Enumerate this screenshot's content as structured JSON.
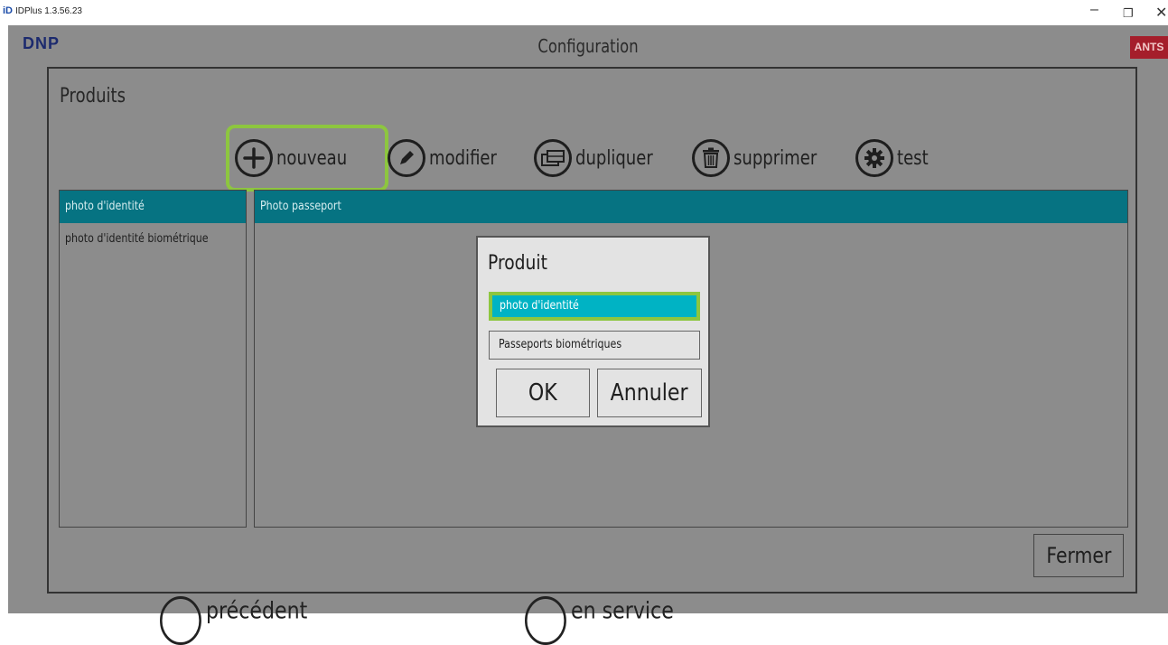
{
  "window": {
    "title": "IDPlus 1.3.56.23",
    "app_icon_text": "iD",
    "buttons": [
      "minimize",
      "restore",
      "close"
    ]
  },
  "app": {
    "brand": "DNP",
    "title": "Configuration",
    "badge": "ANTS",
    "bottom_nav": {
      "previous": "précédent",
      "in_service": "en service"
    }
  },
  "panel": {
    "title": "Produits",
    "toolbar": [
      {
        "label": "nouveau",
        "icon": "plus-icon"
      },
      {
        "label": "modifier",
        "icon": "pencil-icon"
      },
      {
        "label": "dupliquer",
        "icon": "duplicate-icon"
      },
      {
        "label": "supprimer",
        "icon": "trash-icon"
      },
      {
        "label": "test",
        "icon": "gear-icon"
      }
    ],
    "left_list": [
      "photo d'identité",
      "photo d'identité biométrique"
    ],
    "right_list": [
      "Photo passeport"
    ],
    "close_label": "Fermer"
  },
  "dialog": {
    "title": "Produit",
    "options": [
      "photo d'identité",
      "Passeports biométriques"
    ],
    "ok_label": "OK",
    "cancel_label": "Annuler"
  },
  "colors": {
    "background": "#8c8c8c",
    "selection": "#067382",
    "dialog_selection": "#00b3c4",
    "highlight": "#8dc63f",
    "badge": "#a51e2b"
  }
}
